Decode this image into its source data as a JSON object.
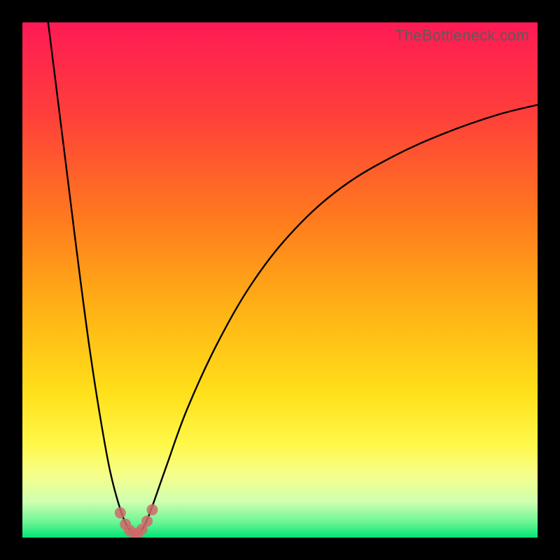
{
  "watermark": "TheBottleneck.com",
  "chart_data": {
    "type": "line",
    "title": "",
    "xlabel": "",
    "ylabel": "",
    "xlim": [
      0,
      100
    ],
    "ylim": [
      0,
      100
    ],
    "grid": false,
    "legend": false,
    "gradient_stops": [
      {
        "offset": 0.0,
        "color": "#ff1a55"
      },
      {
        "offset": 0.18,
        "color": "#ff3f3a"
      },
      {
        "offset": 0.38,
        "color": "#ff7a1e"
      },
      {
        "offset": 0.55,
        "color": "#ffb015"
      },
      {
        "offset": 0.72,
        "color": "#ffe01a"
      },
      {
        "offset": 0.82,
        "color": "#fff84a"
      },
      {
        "offset": 0.88,
        "color": "#f5ff8c"
      },
      {
        "offset": 0.93,
        "color": "#cfffb0"
      },
      {
        "offset": 0.97,
        "color": "#6cf594"
      },
      {
        "offset": 1.0,
        "color": "#00e676"
      }
    ],
    "series": [
      {
        "name": "bottleneck-curve",
        "color": "#000000",
        "points": [
          {
            "x": 5.0,
            "y": 100.0
          },
          {
            "x": 7.0,
            "y": 84.0
          },
          {
            "x": 9.0,
            "y": 68.0
          },
          {
            "x": 11.0,
            "y": 52.0
          },
          {
            "x": 13.0,
            "y": 37.0
          },
          {
            "x": 15.0,
            "y": 24.0
          },
          {
            "x": 17.0,
            "y": 13.0
          },
          {
            "x": 19.0,
            "y": 5.5
          },
          {
            "x": 20.5,
            "y": 2.0
          },
          {
            "x": 22.0,
            "y": 0.5
          },
          {
            "x": 23.5,
            "y": 2.0
          },
          {
            "x": 25.0,
            "y": 5.5
          },
          {
            "x": 28.0,
            "y": 14.0
          },
          {
            "x": 32.0,
            "y": 25.0
          },
          {
            "x": 38.0,
            "y": 38.0
          },
          {
            "x": 45.0,
            "y": 50.0
          },
          {
            "x": 53.0,
            "y": 60.0
          },
          {
            "x": 62.0,
            "y": 68.0
          },
          {
            "x": 72.0,
            "y": 74.0
          },
          {
            "x": 82.0,
            "y": 78.5
          },
          {
            "x": 92.0,
            "y": 82.0
          },
          {
            "x": 100.0,
            "y": 84.0
          }
        ]
      }
    ],
    "markers": {
      "name": "optimal-zone-markers",
      "color": "#cf6a6a",
      "points": [
        {
          "x": 19.0,
          "y": 4.8
        },
        {
          "x": 20.0,
          "y": 2.6
        },
        {
          "x": 20.8,
          "y": 1.4
        },
        {
          "x": 21.6,
          "y": 0.8
        },
        {
          "x": 22.4,
          "y": 0.8
        },
        {
          "x": 23.2,
          "y": 1.6
        },
        {
          "x": 24.2,
          "y": 3.2
        },
        {
          "x": 25.2,
          "y": 5.4
        }
      ]
    }
  }
}
